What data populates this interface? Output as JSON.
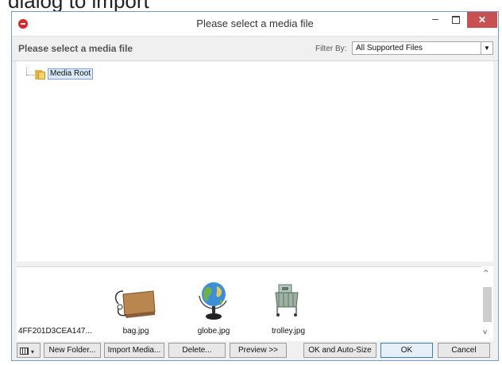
{
  "caption": {
    "text": "dialog to import"
  },
  "window": {
    "title": "Please select a media file",
    "minimize": "–",
    "close": "✕"
  },
  "header": {
    "title": "Please select a media file",
    "filter_label": "Filter By:",
    "filter_value": "All Supported Files"
  },
  "tree": {
    "root_label": "Media Root"
  },
  "media": [
    {
      "label": "4FF201D3CEA147...",
      "icon": "blank-file-icon"
    },
    {
      "label": "bag.jpg",
      "icon": "bag-thumbnail"
    },
    {
      "label": "globe.jpg",
      "icon": "globe-thumbnail"
    },
    {
      "label": "trolley.jpg",
      "icon": "trolley-thumbnail"
    }
  ],
  "footer": {
    "new_folder": "New Folder...",
    "import_media": "Import Media...",
    "delete": "Delete...",
    "preview": "Preview >>",
    "ok_auto_size": "OK and Auto-Size",
    "ok": "OK",
    "cancel": "Cancel"
  },
  "colors": {
    "close_button": "#c75050",
    "app_icon": "#d9262c",
    "selection": "#dce9f8"
  }
}
